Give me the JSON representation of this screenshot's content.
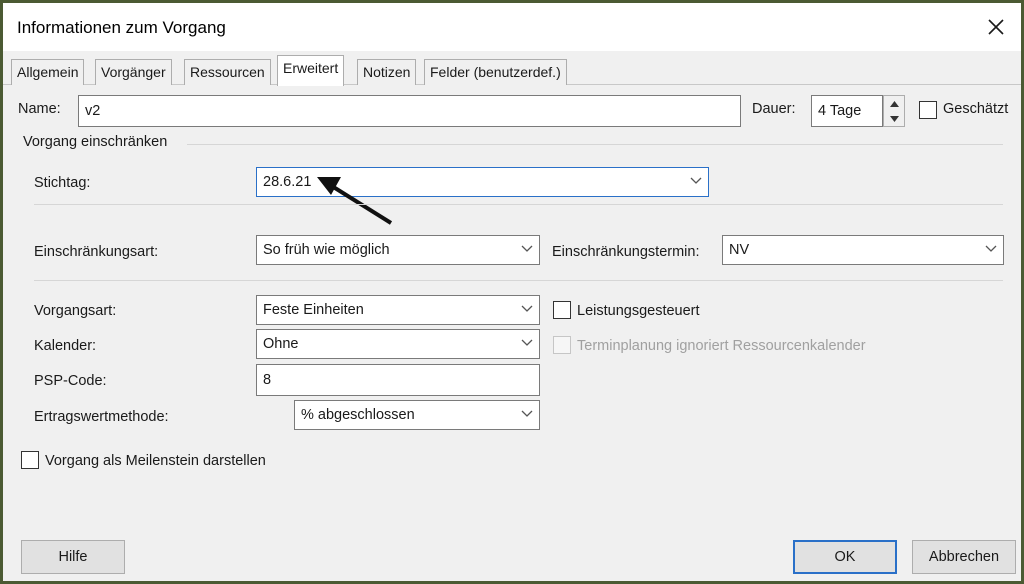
{
  "window": {
    "title": "Informationen zum Vorgang",
    "close_glyph": "✕"
  },
  "tabs": [
    {
      "label": "Allgemein",
      "active": false
    },
    {
      "label": "Vorgänger",
      "active": false
    },
    {
      "label": "Ressourcen",
      "active": false
    },
    {
      "label": "Erweitert",
      "active": true
    },
    {
      "label": "Notizen",
      "active": false
    },
    {
      "label": "Felder (benutzerdef.)",
      "active": false
    }
  ],
  "name": {
    "label": "Name:",
    "value": "v2"
  },
  "dauer": {
    "label": "Dauer:",
    "value": "4 Tage"
  },
  "geschaetzt": {
    "label": "Geschätzt",
    "checked": false
  },
  "group": {
    "title": "Vorgang einschränken"
  },
  "stichtag": {
    "label": "Stichtag:",
    "value": "28.6.21"
  },
  "einschraenkungsart": {
    "label": "Einschränkungsart:",
    "value": "So früh wie möglich"
  },
  "einschraenkungstermin": {
    "label": "Einschränkungstermin:",
    "value": "NV"
  },
  "vorgangsart": {
    "label": "Vorgangsart:",
    "value": "Feste Einheiten"
  },
  "leistungsgesteuert": {
    "label": "Leistungsgesteuert",
    "checked": false
  },
  "kalender": {
    "label": "Kalender:",
    "value": "Ohne"
  },
  "terminplanung": {
    "label": "Terminplanung ignoriert Ressourcenkalender",
    "checked": false,
    "enabled": false
  },
  "psp": {
    "label": "PSP-Code:",
    "value": "8"
  },
  "ertragswert": {
    "label": "Ertragswertmethode:",
    "value": "% abgeschlossen"
  },
  "meilenstein": {
    "label": "Vorgang als Meilenstein darstellen",
    "checked": false
  },
  "buttons": {
    "help": "Hilfe",
    "ok": "OK",
    "cancel": "Abbrechen"
  },
  "colors": {
    "accent": "#2a70c8",
    "frame": "#4b5a33",
    "dialog_bg": "#f0f0f0"
  },
  "icons": {
    "dropdown": "chevron-down-icon",
    "annotation": "arrow-icon"
  }
}
